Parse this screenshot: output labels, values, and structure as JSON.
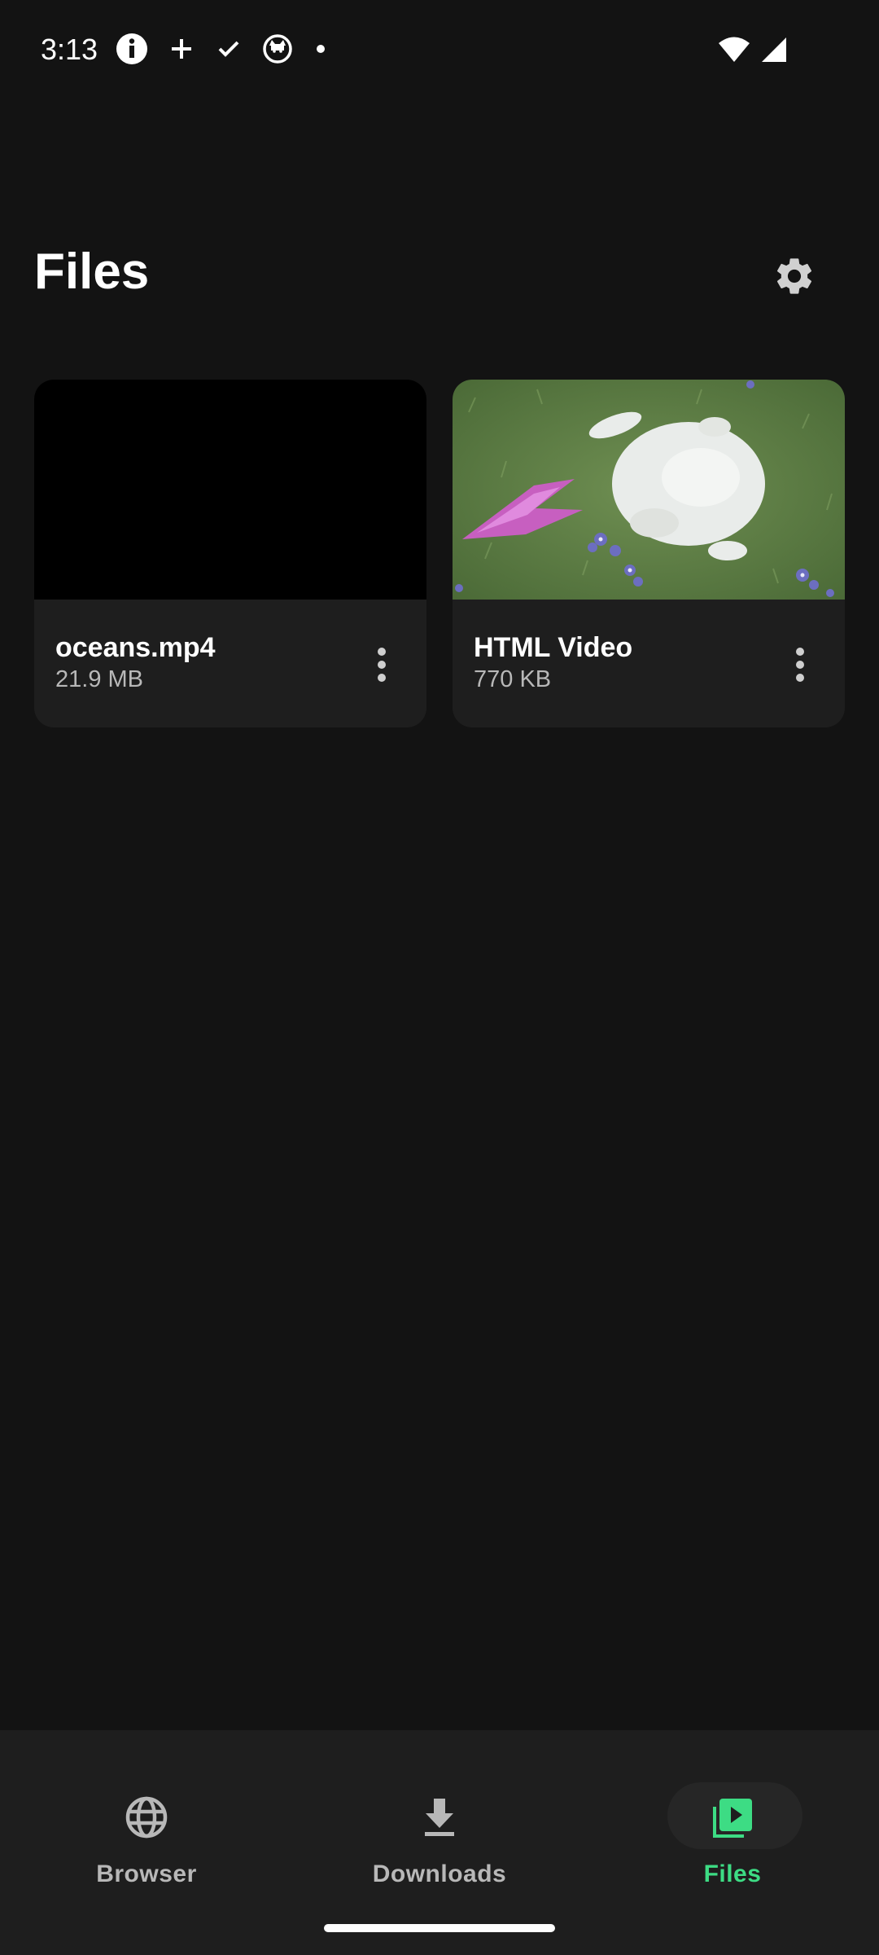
{
  "status_bar": {
    "time": "3:13",
    "left_icons": [
      "info-icon",
      "plus-icon",
      "check-icon",
      "cat-icon",
      "dot-icon"
    ],
    "right_icons": [
      "wifi-icon",
      "signal-icon"
    ]
  },
  "header": {
    "title": "Files",
    "settings_icon": "gear-icon"
  },
  "files": [
    {
      "name": "oceans.mp4",
      "size": "21.9 MB",
      "thumbnail": "black-frame"
    },
    {
      "name": "HTML Video",
      "size": "770 KB",
      "thumbnail": "bunny-on-grass"
    }
  ],
  "bottom_nav": {
    "items": [
      {
        "label": "Browser",
        "icon": "globe-icon",
        "active": false
      },
      {
        "label": "Downloads",
        "icon": "download-icon",
        "active": false
      },
      {
        "label": "Files",
        "icon": "video-library-icon",
        "active": true
      }
    ]
  },
  "colors": {
    "background": "#131313",
    "surface": "#1e1e1e",
    "accent": "#3ddc84",
    "secondary_text": "#b8b8b8"
  }
}
